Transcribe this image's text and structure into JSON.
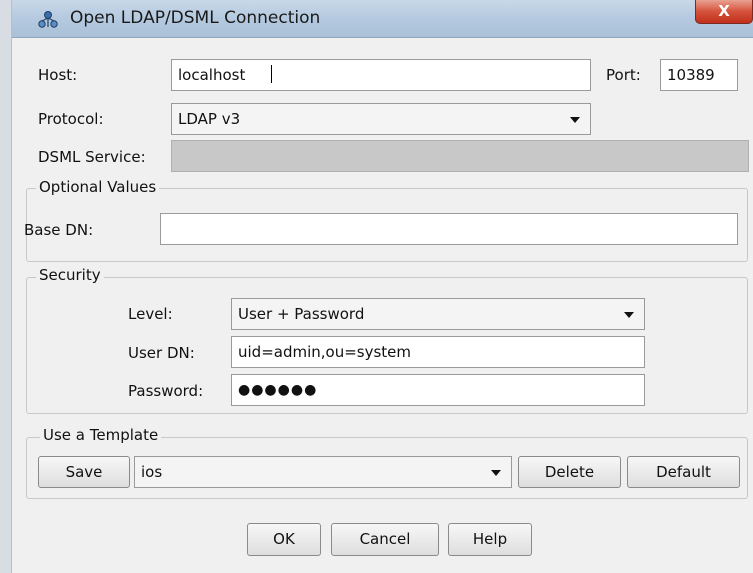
{
  "window": {
    "title": "Open LDAP/DSML Connection",
    "close_label": "X"
  },
  "connection": {
    "host_label": "Host:",
    "host_value": "localhost",
    "port_label": "Port:",
    "port_value": "10389",
    "protocol_label": "Protocol:",
    "protocol_value": "LDAP v3",
    "dsml_label": "DSML Service:",
    "dsml_value": ""
  },
  "optional_values": {
    "legend": "Optional Values",
    "base_dn_label": "Base DN:",
    "base_dn_value": ""
  },
  "security": {
    "legend": "Security",
    "level_label": "Level:",
    "level_value": "User + Password",
    "user_dn_label": "User DN:",
    "user_dn_value": "uid=admin,ou=system",
    "password_label": "Password:",
    "password_value": "●●●●●●"
  },
  "template": {
    "legend": "Use a Template",
    "save_label": "Save",
    "template_value": "ios",
    "delete_label": "Delete",
    "default_label": "Default"
  },
  "footer": {
    "ok_label": "OK",
    "cancel_label": "Cancel",
    "help_label": "Help"
  },
  "icons": {
    "app": "ldap-tree-icon",
    "dropdown": "chevron-down-icon"
  }
}
